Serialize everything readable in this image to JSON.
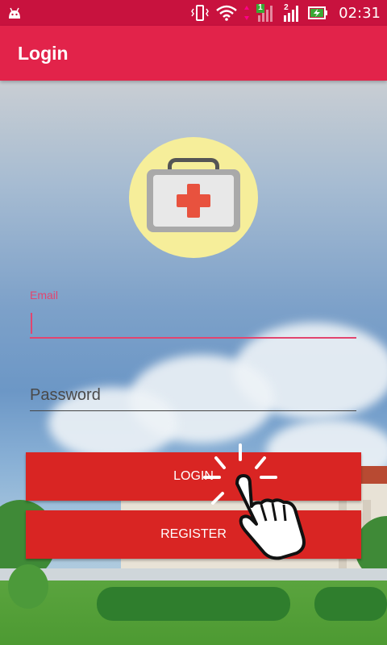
{
  "status_bar": {
    "time": "02:31",
    "sim1_label": "1",
    "sim2_label": "2",
    "icons": [
      "android-icon",
      "vibrate-icon",
      "wifi-icon",
      "data-arrows-icon",
      "signal-sim1-icon",
      "signal-sim2-icon",
      "battery-charging-icon"
    ]
  },
  "app_bar": {
    "title": "Login"
  },
  "logo": {
    "icon": "first-aid-kit-icon",
    "circle_color": "#f6ee9a",
    "cross_color": "#e8523e"
  },
  "form": {
    "email_label": "Email",
    "email_value": "",
    "password_placeholder": "Password",
    "password_value": ""
  },
  "buttons": {
    "login_label": "LOGIN",
    "register_label": "REGISTER"
  },
  "colors": {
    "status_bar": "#c8123e",
    "app_bar": "#e2234a",
    "accent": "#e2456f",
    "button": "#d92523"
  },
  "overlay": {
    "icon": "tap-hand-cursor-icon"
  }
}
